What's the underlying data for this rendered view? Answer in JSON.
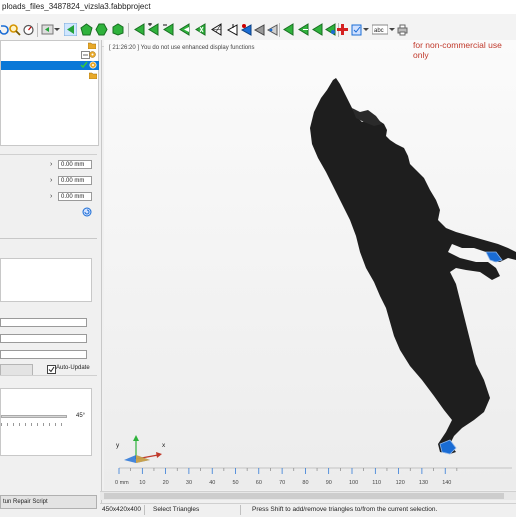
{
  "window": {
    "title": "ploads_files_3487824_vizsla3.fabbproject"
  },
  "viewport": {
    "log_message": "[ 21:26:20 ] You do not use enhanced display functions",
    "license_notice": "for non-commercial use only"
  },
  "properties": {
    "fields": [
      "0.00 mm",
      "0.00 mm",
      "0.00 mm"
    ]
  },
  "repair": {
    "auto_update_label": "Auto-Update",
    "angle_value": "45°",
    "run_script_label": "tun Repair Script"
  },
  "ruler": {
    "labels": [
      "0 mm",
      "10",
      "20",
      "30",
      "40",
      "50",
      "60",
      "70",
      "80",
      "90",
      "100",
      "110",
      "120",
      "130",
      "140"
    ]
  },
  "axis": {
    "y": "y",
    "x": "x"
  },
  "status": {
    "dimensions": "450x420x400",
    "mode": "Select Triangles",
    "hint": "Press Shift to add/remove triangles to/from the current selection."
  },
  "colors": {
    "selection": "#0a78d7",
    "license_text": "#c0392b",
    "model": "#1e1e1e"
  },
  "icons": [
    "undo-icon",
    "search-icon",
    "measure-icon",
    "view-first-icon",
    "view-dropdown-icon",
    "arrow-left-icon",
    "pentagon-green-icon",
    "hexagon-green-icon",
    "cube-green-icon",
    "triangle-select-icon",
    "triangle-add-icon",
    "triangle-remove-icon",
    "triangle-fill-icon",
    "triangle-cross-icon",
    "triangle-wire-icon",
    "triangle-move-icon",
    "triangle-paint-icon",
    "triangle-shade-icon",
    "triangle-gray-icon",
    "triangle-arrow-icon",
    "arrow-right-icon",
    "arrow-left2-icon",
    "tri-marker-icon",
    "tri-wave-icon",
    "red-cross-icon",
    "clipboard-icon",
    "text-abc-icon",
    "printer-icon"
  ]
}
